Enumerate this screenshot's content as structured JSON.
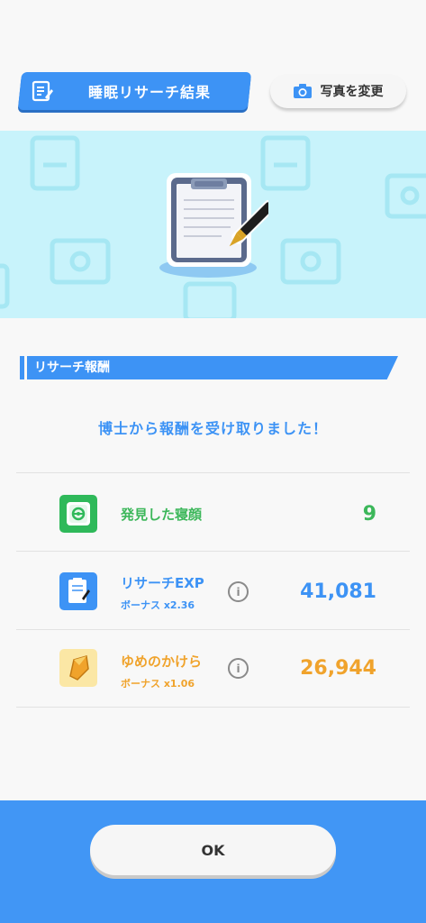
{
  "header": {
    "title": "睡眠リサーチ結果",
    "photo_button": "写真を変更"
  },
  "section": {
    "label": "リサーチ報酬",
    "message": "博士から報酬を受け取りました！"
  },
  "rewards": [
    {
      "title": "発見した寝顔",
      "bonus": "",
      "value": "9",
      "color": "#3cb75a",
      "icon": "pokedex-icon"
    },
    {
      "title": "リサーチEXP",
      "bonus": "ボーナス x2.36",
      "value": "41,081",
      "color": "#3d93f5",
      "icon": "research-notepad-icon"
    },
    {
      "title": "ゆめのかけら",
      "bonus": "ボーナス x1.06",
      "value": "26,944",
      "color": "#f0a32c",
      "icon": "dream-shard-icon"
    }
  ],
  "footer": {
    "ok_label": "OK"
  }
}
